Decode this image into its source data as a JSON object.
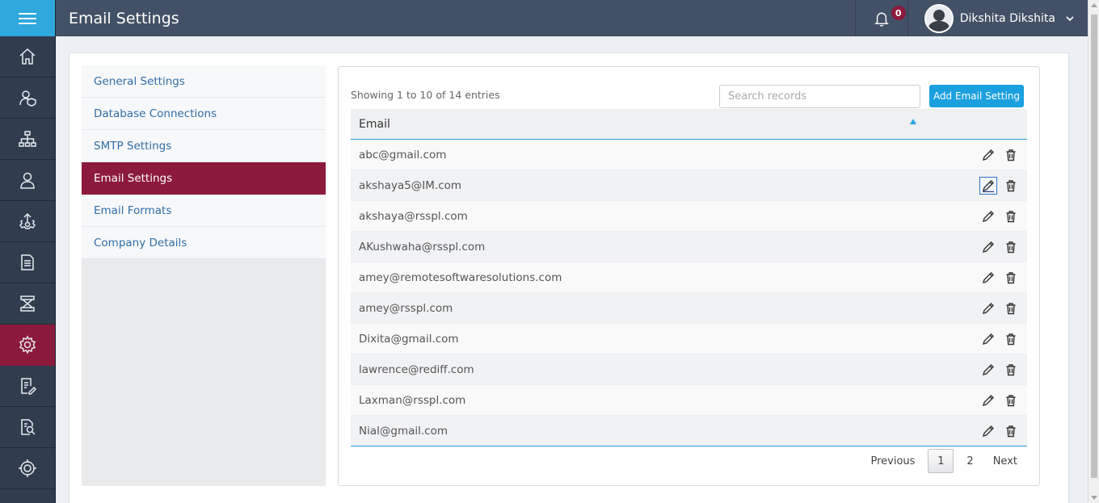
{
  "header": {
    "title": "Email Settings",
    "notification_count": "0",
    "user_name": "Dikshita Dikshita"
  },
  "rail": {
    "items": [
      {
        "icon": "home-icon",
        "active": false
      },
      {
        "icon": "user-shield-icon",
        "active": false
      },
      {
        "icon": "org-chart-icon",
        "active": false
      },
      {
        "icon": "user-icon",
        "active": false
      },
      {
        "icon": "upload-gear-icon",
        "active": false
      },
      {
        "icon": "document-icon",
        "active": false
      },
      {
        "icon": "scanner-icon",
        "active": false
      },
      {
        "icon": "gear-icon",
        "active": true
      },
      {
        "icon": "document-edit-icon",
        "active": false
      },
      {
        "icon": "document-search-icon",
        "active": false
      },
      {
        "icon": "target-icon",
        "active": false
      }
    ]
  },
  "settings_nav": {
    "items": [
      {
        "label": "General Settings",
        "active": false
      },
      {
        "label": "Database Connections",
        "active": false
      },
      {
        "label": "SMTP Settings",
        "active": false
      },
      {
        "label": "Email Settings",
        "active": true
      },
      {
        "label": "Email Formats",
        "active": false
      },
      {
        "label": "Company Details",
        "active": false
      }
    ]
  },
  "table_panel": {
    "info": "Showing 1 to 10 of 14 entries",
    "search_placeholder": "Search records",
    "add_button_label": "Add Email Setting",
    "column_header": "Email",
    "rows": [
      "abc@gmail.com",
      "akshaya5@IM.com",
      "akshaya@rsspl.com",
      "AKushwaha@rsspl.com",
      "amey@remotesoftwaresolutions.com",
      "amey@rsspl.com",
      "Dixita@gmail.com",
      "lawrence@rediff.com",
      "Laxman@rsspl.com",
      "Nial@gmail.com"
    ],
    "pagination": {
      "previous": "Previous",
      "pages": [
        "1",
        "2"
      ],
      "current": "1",
      "next": "Next"
    }
  },
  "colors": {
    "accent": "#1aa0de",
    "active": "#8c1a3c",
    "header": "#425166",
    "rail": "#2f3d4f"
  }
}
